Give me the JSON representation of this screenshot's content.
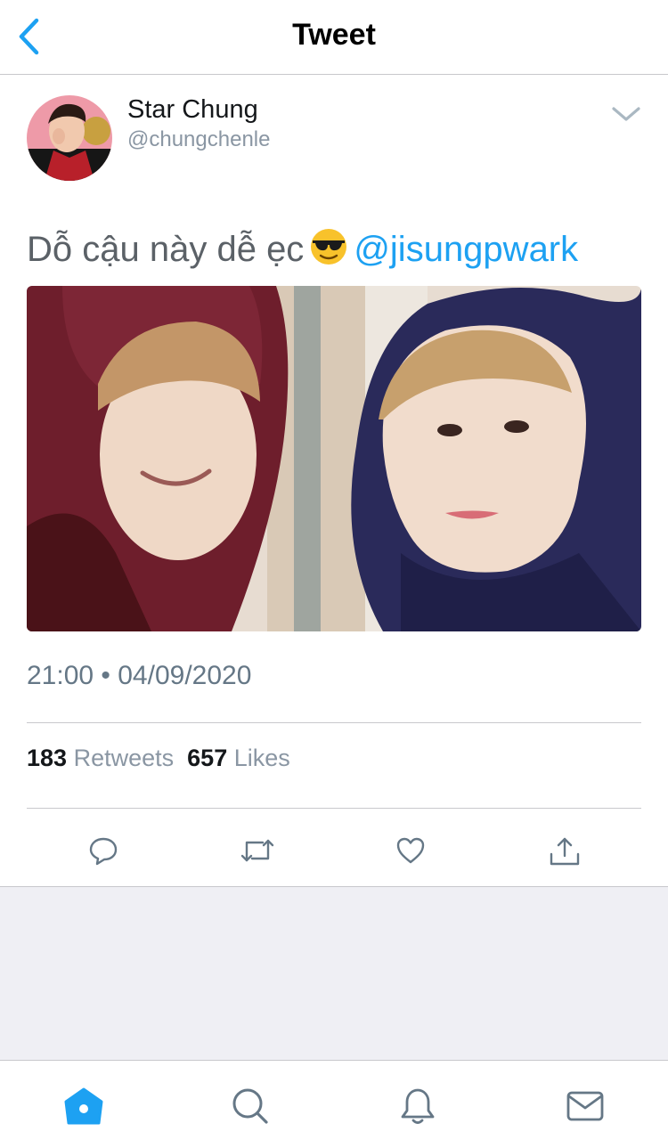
{
  "header": {
    "title": "Tweet"
  },
  "author": {
    "name": "Star Chung",
    "handle": "@chungchenle"
  },
  "tweet": {
    "text": "Dỗ cậu này dễ ẹc",
    "emoji": "smiling-face-with-sunglasses-icon",
    "mention": "@jisungpwark",
    "timestamp": "21:00 • 04/09/2020"
  },
  "stats": {
    "retweets_count": "183",
    "retweets_label": "Retweets",
    "likes_count": "657",
    "likes_label": "Likes"
  },
  "actions": [
    {
      "icon": "reply-icon"
    },
    {
      "icon": "retweet-icon"
    },
    {
      "icon": "heart-icon"
    },
    {
      "icon": "share-icon"
    }
  ],
  "tabbar": {
    "tabs": [
      {
        "icon": "home-icon",
        "active": true
      },
      {
        "icon": "search-icon",
        "active": false
      },
      {
        "icon": "notifications-icon",
        "active": false
      },
      {
        "icon": "messages-icon",
        "active": false
      }
    ]
  },
  "colors": {
    "accent": "#1da1f2",
    "text_primary": "#14171a",
    "text_secondary": "#657786",
    "divider": "#c8c8cc",
    "background_gray": "#efeff4"
  }
}
